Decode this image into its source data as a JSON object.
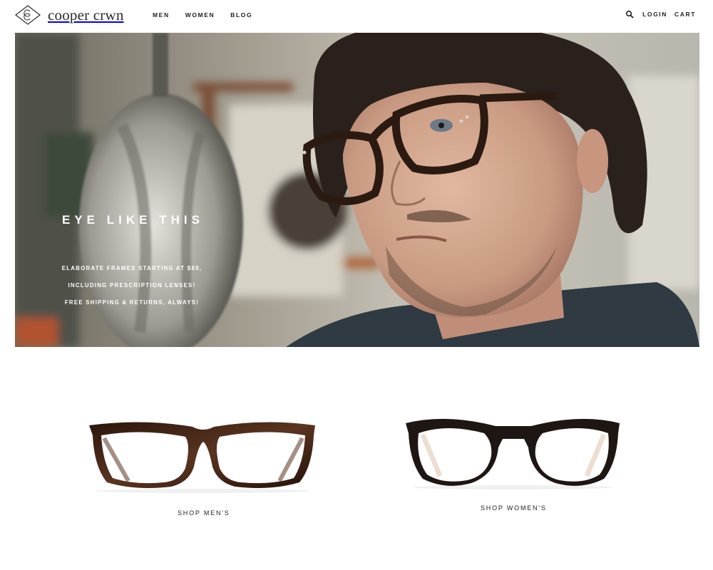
{
  "brand": {
    "name": "cooper crwn",
    "mark_letters": "CC"
  },
  "nav": {
    "men": "MEN",
    "women": "WOMEN",
    "blog": "BLOG"
  },
  "header_right": {
    "search_icon": "search-icon",
    "login": "LOGIN",
    "cart": "CART"
  },
  "hero": {
    "title": "EYE LIKE THIS",
    "lines": [
      "ELABORATE FRAMES STARTING AT $89,",
      "INCLUDING PRESCRIPTION LENSES!",
      "FREE SHIPPING & RETURNS, ALWAYS!"
    ]
  },
  "products": {
    "men": {
      "label": "SHOP MEN'S"
    },
    "women": {
      "label": "SHOP WOMEN'S"
    }
  },
  "colors": {
    "frame_tortoise": "#3a2418",
    "frame_black": "#1e1612",
    "text": "#222222"
  }
}
